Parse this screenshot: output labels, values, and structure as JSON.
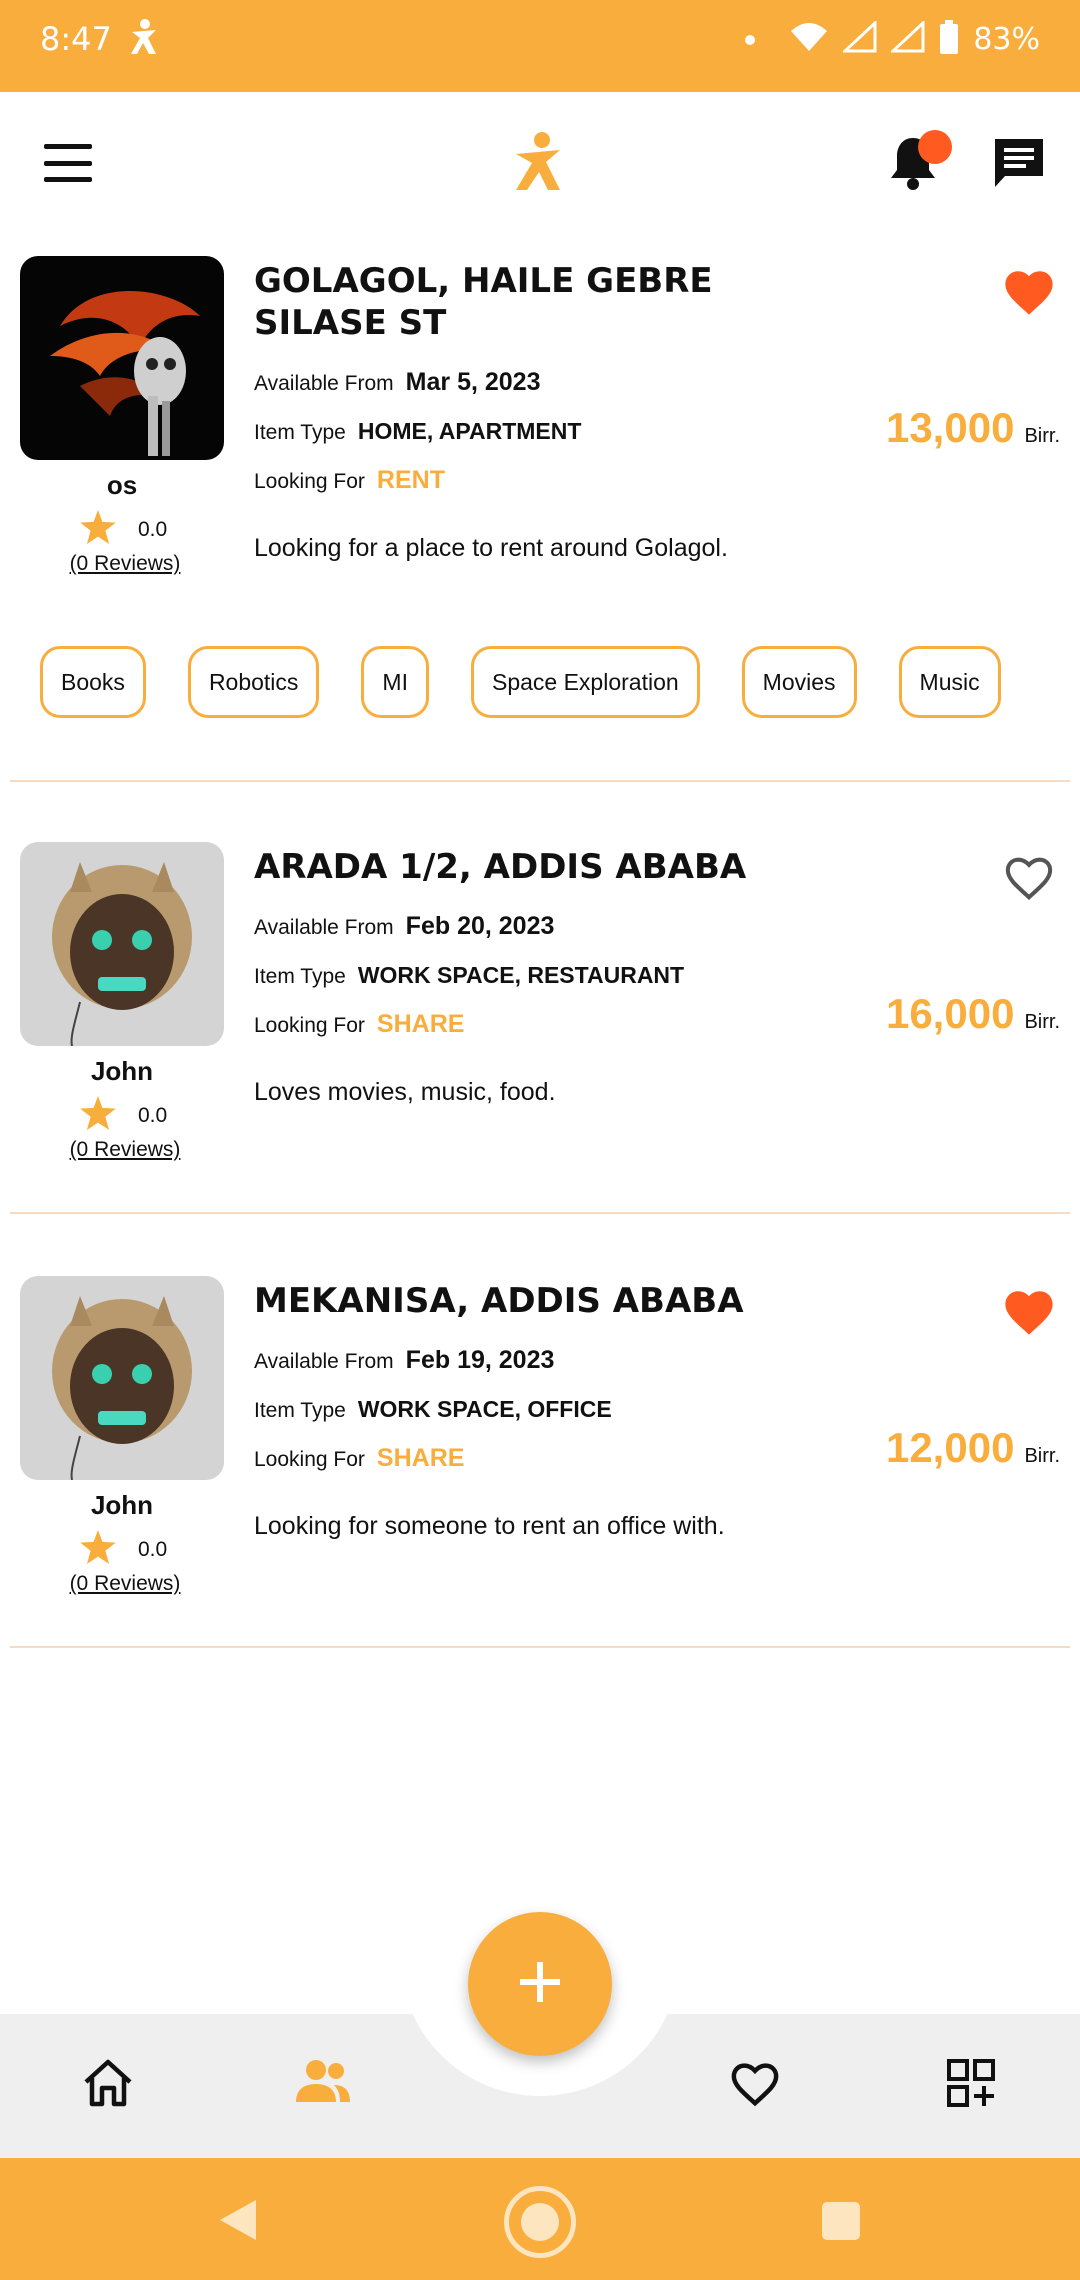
{
  "status_bar": {
    "time": "8:47",
    "battery": "83%"
  },
  "colors": {
    "accent": "#f9ad3c",
    "favorite": "#ff5a1f",
    "separator": "#f3dcc2"
  },
  "listings": [
    {
      "user": {
        "name": "os",
        "rating": "0.0",
        "reviews": "(0 Reviews)"
      },
      "title": "GOLAGOL, HAILE GEBRE SILASE ST",
      "available_label": "Available From",
      "available": "Mar 5, 2023",
      "type_label": "Item Type",
      "type": "HOME, APARTMENT",
      "looking_label": "Looking For",
      "looking": "RENT",
      "description": "Looking for a place to rent around Golagol.",
      "price": "13,000",
      "currency": "Birr.",
      "favorited": true
    },
    {
      "user": {
        "name": "John",
        "rating": "0.0",
        "reviews": "(0 Reviews)"
      },
      "title": "ARADA 1/2, ADDIS ABABA",
      "available_label": "Available From",
      "available": "Feb 20, 2023",
      "type_label": "Item Type",
      "type": "WORK SPACE, RESTAURANT",
      "looking_label": "Looking For",
      "looking": "SHARE",
      "description": "Loves movies, music, food.",
      "price": "16,000",
      "currency": "Birr.",
      "favorited": false
    },
    {
      "user": {
        "name": "John",
        "rating": "0.0",
        "reviews": "(0 Reviews)"
      },
      "title": "MEKANISA, ADDIS ABABA",
      "available_label": "Available From",
      "available": "Feb 19, 2023",
      "type_label": "Item Type",
      "type": "WORK SPACE, OFFICE",
      "looking_label": "Looking For",
      "looking": "SHARE",
      "description": "Looking for someone to rent an office with.",
      "price": "12,000",
      "currency": "Birr.",
      "favorited": true
    }
  ],
  "tags": [
    "Books",
    "Robotics",
    "MI",
    "Space Exploration",
    "Movies",
    "Music"
  ],
  "bottom_nav": {
    "items": [
      {
        "icon": "home-icon",
        "active": false
      },
      {
        "icon": "people-icon",
        "active": true
      },
      {
        "icon": "heart-outline-icon",
        "active": false
      },
      {
        "icon": "grid-add-icon",
        "active": false
      }
    ],
    "fab_icon": "plus-icon"
  }
}
